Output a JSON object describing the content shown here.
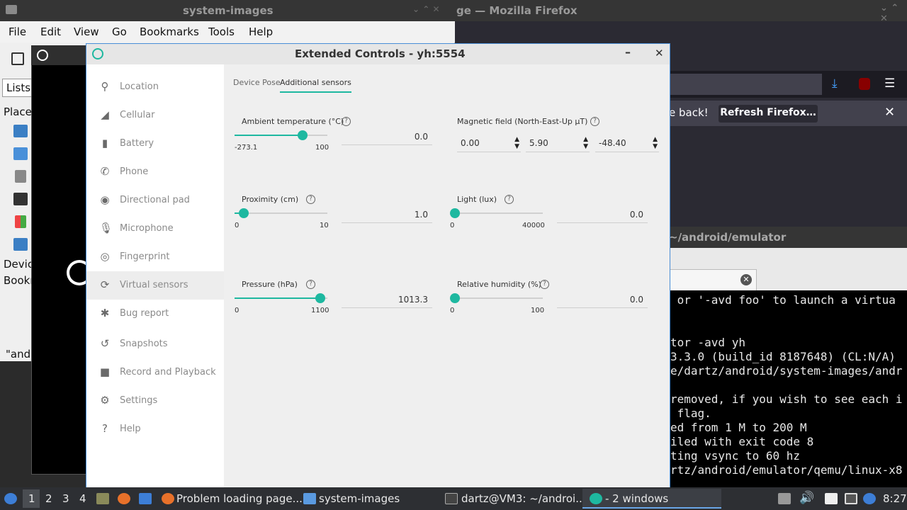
{
  "file_manager": {
    "title": "system-images",
    "menu": [
      "File",
      "Edit",
      "View",
      "Go",
      "Bookmarks",
      "Tools",
      "Help"
    ],
    "lists_label": "Lists",
    "places_label": "Places",
    "devices_label": "Device",
    "bookmarks_label": "Bookm",
    "quote_fragment": "\"andr"
  },
  "firefox": {
    "title_fragment": "ge — Mozilla Firefox",
    "notice_text": "e back!",
    "refresh_label": "Refresh Firefox…"
  },
  "terminal": {
    "title_fragment": "~/android/emulator",
    "lines": [
      " or '-avd foo' to launch a virtua",
      "",
      "tor -avd yh",
      "3.3.0 (build_id 8187648) (CL:N/A)",
      "e/dartz/android/system-images/andr",
      "",
      "removed, if you wish to see each i",
      " flag.",
      "ed from 1 M to 200 M",
      "iled with exit code 8",
      "ting vsync to 60 hz",
      "rtz/android/emulator/qemu/linux-x8"
    ]
  },
  "extended_controls": {
    "title": "Extended Controls - yh:5554",
    "nav": [
      {
        "label": "Location",
        "icon": "location-pin-icon"
      },
      {
        "label": "Cellular",
        "icon": "signal-icon"
      },
      {
        "label": "Battery",
        "icon": "battery-icon"
      },
      {
        "label": "Phone",
        "icon": "phone-icon"
      },
      {
        "label": "Directional pad",
        "icon": "dpad-icon"
      },
      {
        "label": "Microphone",
        "icon": "microphone-icon"
      },
      {
        "label": "Fingerprint",
        "icon": "fingerprint-icon"
      },
      {
        "label": "Virtual sensors",
        "icon": "rotate-icon"
      },
      {
        "label": "Bug report",
        "icon": "bug-icon"
      },
      {
        "label": "Snapshots",
        "icon": "history-icon"
      },
      {
        "label": "Record and Playback",
        "icon": "video-icon"
      },
      {
        "label": "Settings",
        "icon": "gear-icon"
      },
      {
        "label": "Help",
        "icon": "help-icon"
      }
    ],
    "tabs": {
      "device_pose": "Device Pose",
      "additional_sensors": "Additional sensors"
    },
    "ambient": {
      "label": "Ambient temperature (°C)",
      "min": "-273.1",
      "max": "100",
      "value": "0.0",
      "fraction": 0.73
    },
    "magnetic": {
      "label": "Magnetic field (North-East-Up µT)",
      "x": "0.00",
      "y": "5.90",
      "z": "-48.40"
    },
    "proximity": {
      "label": "Proximity (cm)",
      "min": "0",
      "max": "10",
      "value": "1.0",
      "fraction": 0.1
    },
    "light": {
      "label": "Light (lux)",
      "min": "0",
      "max": "40000",
      "value": "0.0",
      "fraction": 0.0
    },
    "pressure": {
      "label": "Pressure (hPa)",
      "min": "0",
      "max": "1100",
      "value": "1013.3",
      "fraction": 0.92
    },
    "humidity": {
      "label": "Relative humidity (%)",
      "min": "0",
      "max": "100",
      "value": "0.0",
      "fraction": 0.0
    }
  },
  "taskbar": {
    "workspaces": [
      "1",
      "2",
      "3",
      "4"
    ],
    "firefox_task": "Problem loading page...",
    "files_task": "system-images",
    "terminal_task": "dartz@VM3: ~/androi...",
    "emu_task": "- 2 windows",
    "clock": "8:27"
  },
  "colors": {
    "accent": "#1eb8a0",
    "title_border": "#4a8fd8"
  }
}
